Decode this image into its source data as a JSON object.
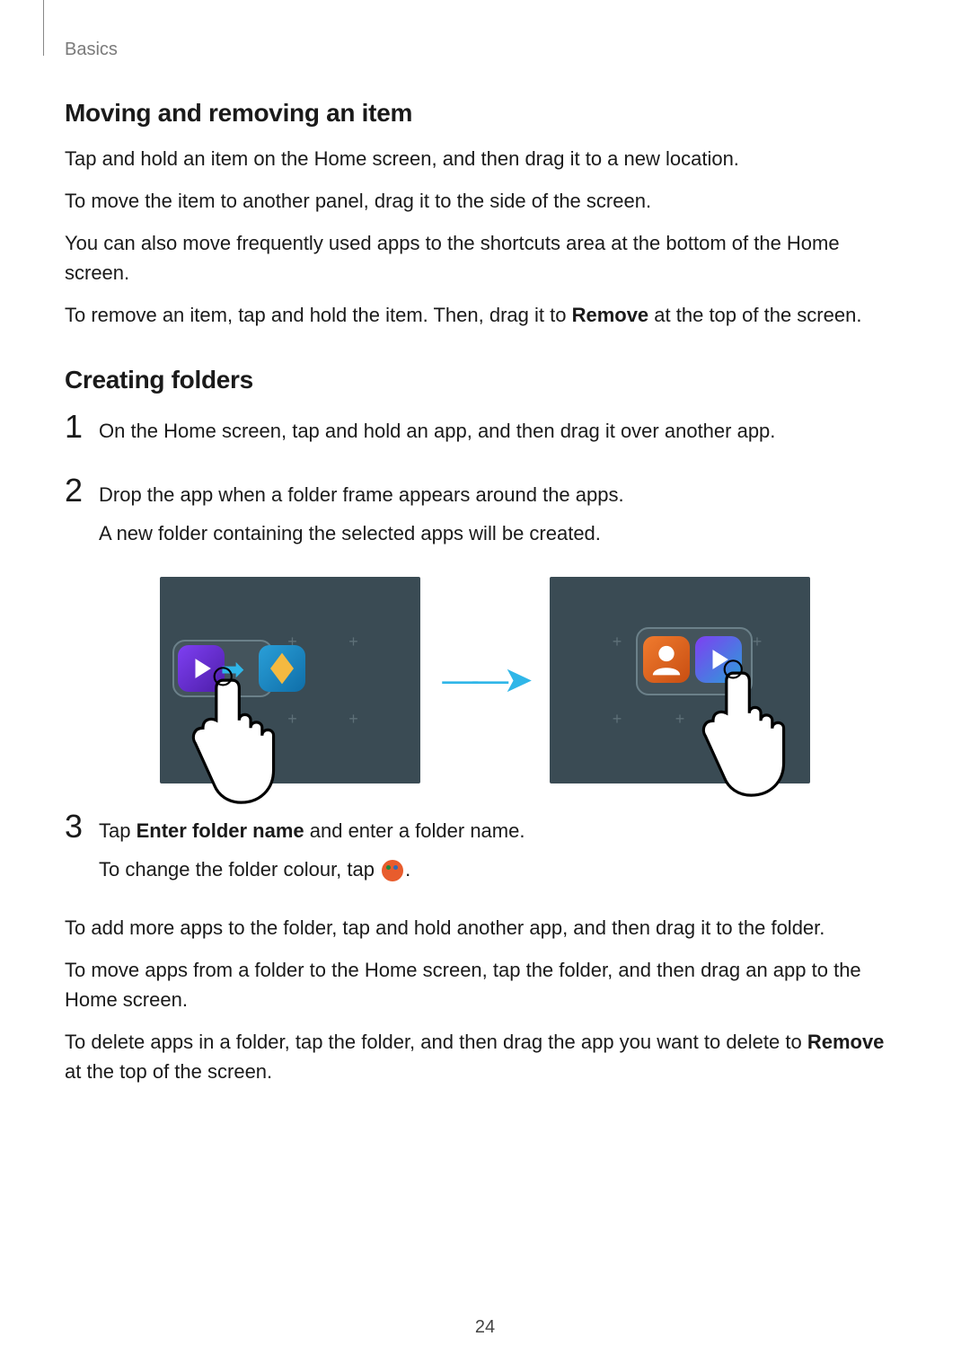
{
  "header": {
    "section": "Basics"
  },
  "s1": {
    "title": "Moving and removing an item",
    "p1": "Tap and hold an item on the Home screen, and then drag it to a new location.",
    "p2": "To move the item to another panel, drag it to the side of the screen.",
    "p3": "You can also move frequently used apps to the shortcuts area at the bottom of the Home screen.",
    "p4_a": "To remove an item, tap and hold the item. Then, drag it to ",
    "p4_b": "Remove",
    "p4_c": " at the top of the screen."
  },
  "s2": {
    "title": "Creating folders",
    "step1": "On the Home screen, tap and hold an app, and then drag it over another app.",
    "step2_a": "Drop the app when a folder frame appears around the apps.",
    "step2_b": "A new folder containing the selected apps will be created.",
    "step3_a": "Tap ",
    "step3_b": "Enter folder name",
    "step3_c": " and enter a folder name.",
    "step3_d": "To change the folder colour, tap ",
    "step3_e": "."
  },
  "after": {
    "p1": "To add more apps to the folder, tap and hold another app, and then drag it to the folder.",
    "p2": "To move apps from a folder to the Home screen, tap the folder, and then drag an app to the Home screen.",
    "p3_a": "To delete apps in a folder, tap the folder, and then drag the app you want to delete to ",
    "p3_b": "Remove",
    "p3_c": " at the top of the screen."
  },
  "nums": {
    "n1": "1",
    "n2": "2",
    "n3": "3"
  },
  "page": "24"
}
